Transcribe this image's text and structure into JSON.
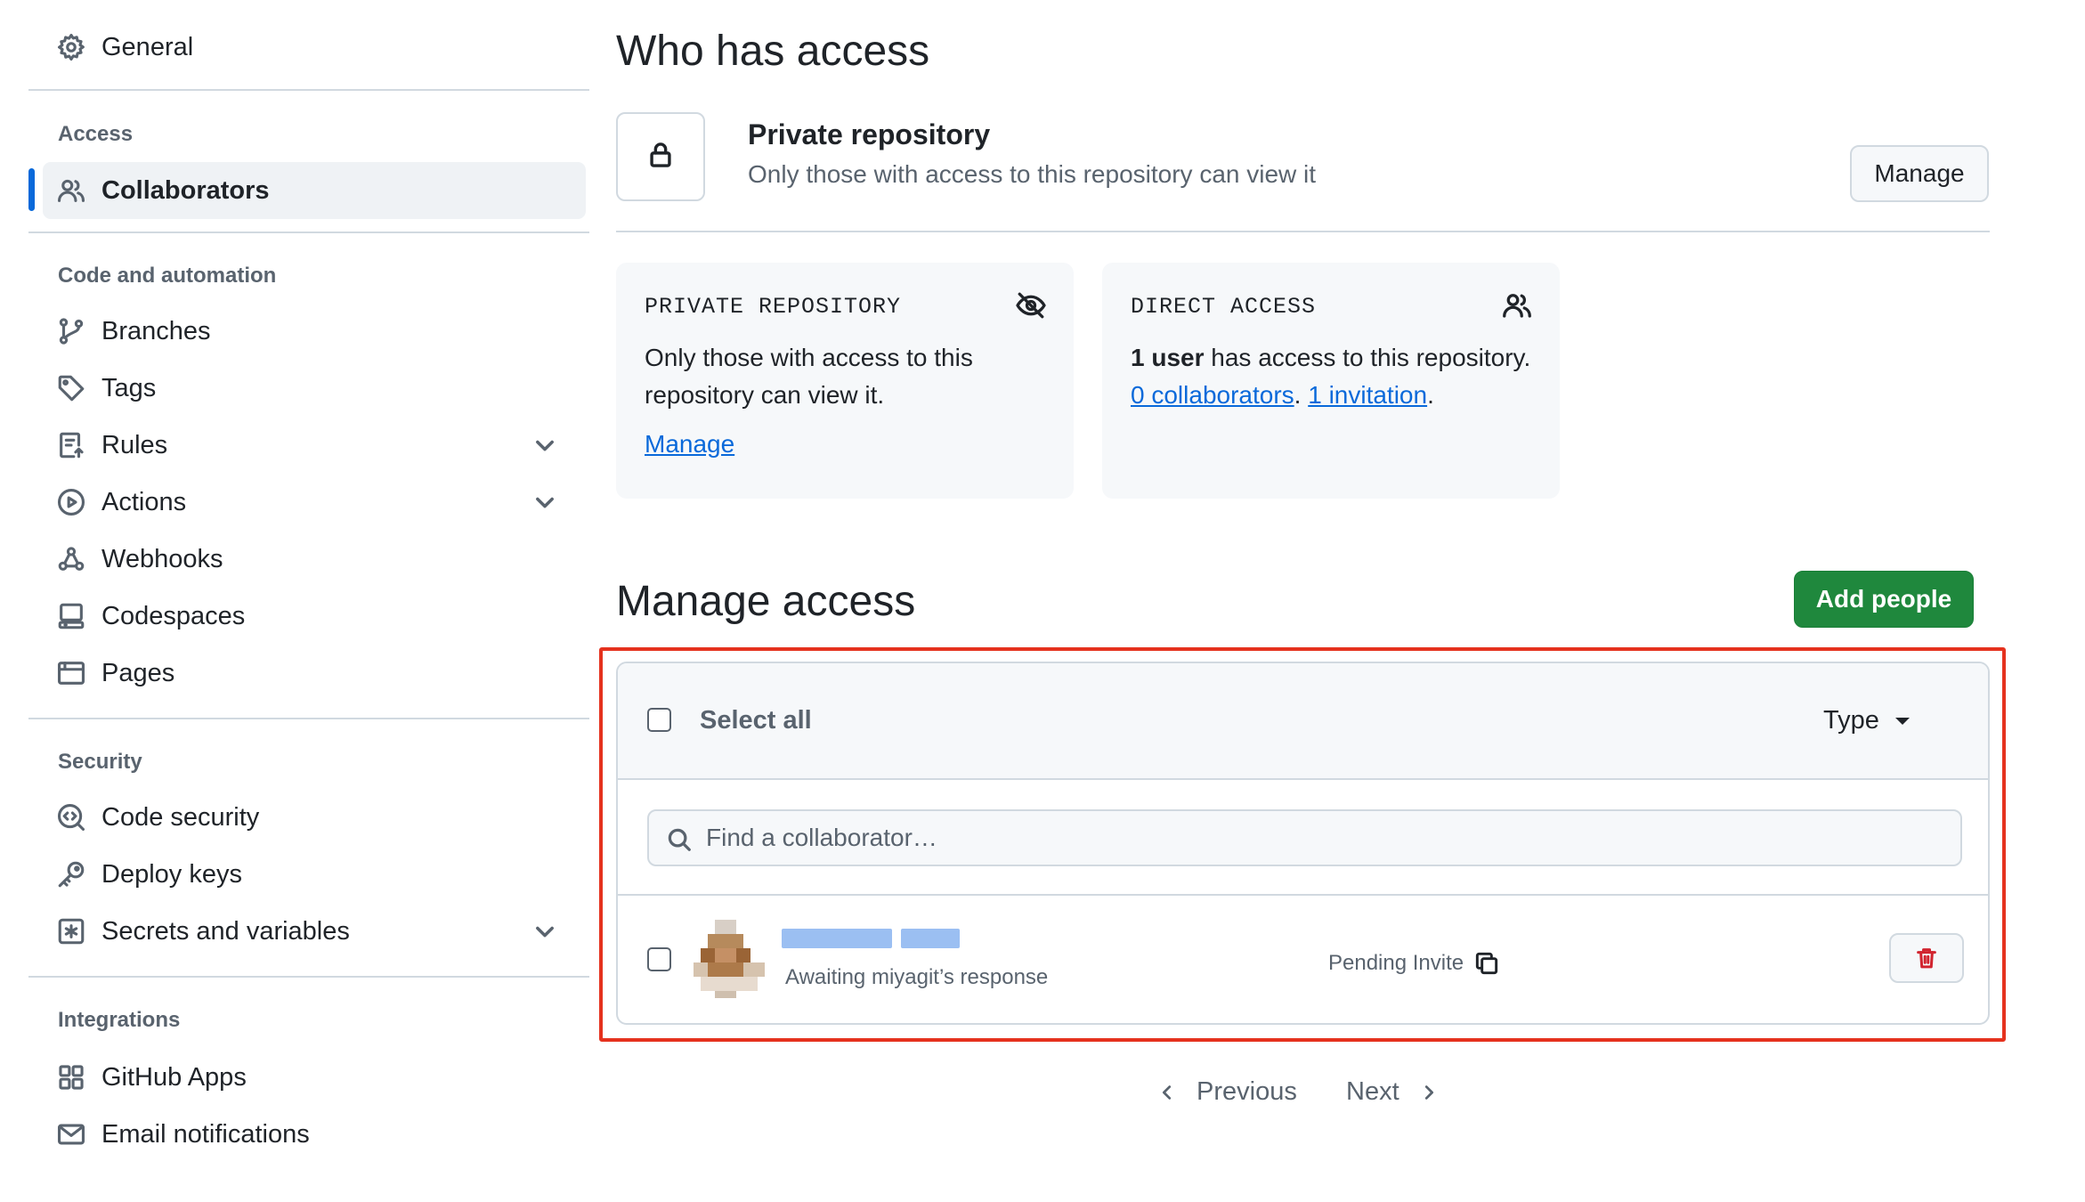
{
  "sidebar": {
    "general": "General",
    "sections": {
      "access": "Access",
      "code_automation": "Code and automation",
      "security": "Security",
      "integrations": "Integrations"
    },
    "items": {
      "collaborators": "Collaborators",
      "branches": "Branches",
      "tags": "Tags",
      "rules": "Rules",
      "actions": "Actions",
      "webhooks": "Webhooks",
      "codespaces": "Codespaces",
      "pages": "Pages",
      "code_security": "Code security",
      "deploy_keys": "Deploy keys",
      "secrets": "Secrets and variables",
      "github_apps": "GitHub Apps",
      "email_notifications": "Email notifications"
    },
    "active_item": "Collaborators"
  },
  "main": {
    "title": "Who has access",
    "private_repo": {
      "title": "Private repository",
      "description": "Only those with access to this repository can view it",
      "manage_button": "Manage"
    },
    "cards": {
      "private": {
        "header": "PRIVATE REPOSITORY",
        "text": "Only those with access to this repository can view it.",
        "link": "Manage"
      },
      "direct": {
        "header": "DIRECT ACCESS",
        "count_bold": "1 user",
        "text_a": " has access to this repository. ",
        "collaborators_link": "0 collaborators",
        "sep": ". ",
        "invitation_link": "1 invitation",
        "end": "."
      }
    },
    "manage_access": {
      "title": "Manage access",
      "add_button": "Add people",
      "select_all": "Select all",
      "type_filter": "Type",
      "search_placeholder": "Find a collaborator…",
      "rows": [
        {
          "status": "Awaiting miyagit’s response",
          "badge": "Pending Invite"
        }
      ]
    },
    "pagination": {
      "previous": "Previous",
      "next": "Next"
    }
  },
  "colors": {
    "accent": "#0969da",
    "primary_button": "#1f883d",
    "danger": "#d1242f",
    "highlight_border": "#e5321e"
  }
}
